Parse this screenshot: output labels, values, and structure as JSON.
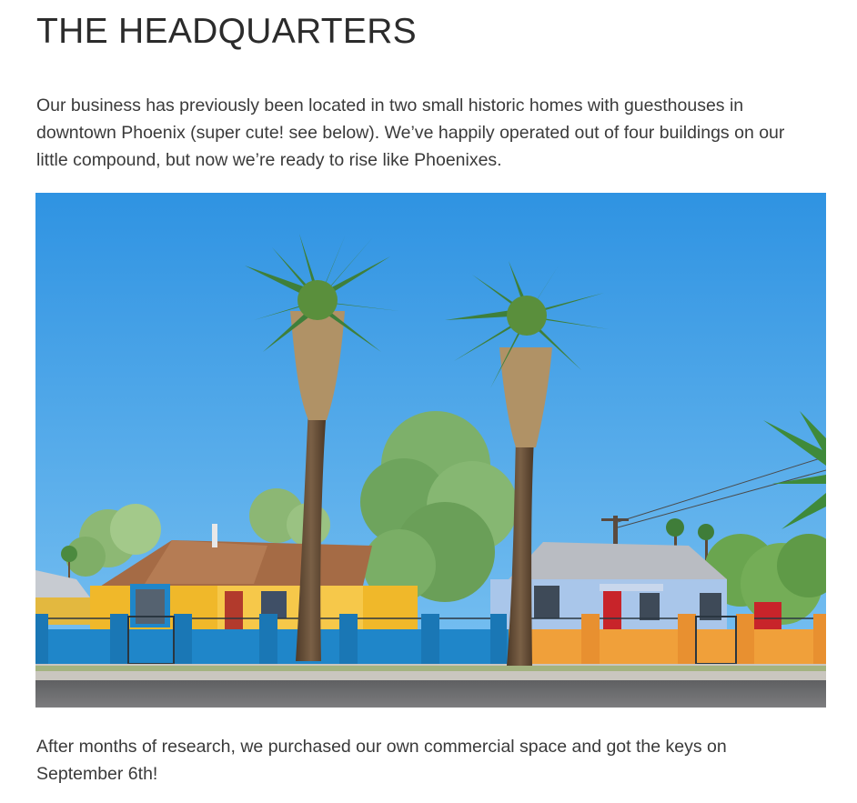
{
  "heading": "THE HEADQUARTERS",
  "intro_paragraph": "Our business has previously been located in two small historic homes with guesthouses in downtown Phoenix (super cute! see below). We’ve happily operated out of four buildings on our little compound, but now we’re ready to rise like Phoenixes.",
  "closing_paragraph": "After months of research, we purchased our own commercial space and got the keys on September 6th!",
  "colors": {
    "sky": "#3d9fe6",
    "yellow_house": "#f0b82a",
    "blue_house": "#a9c6ea",
    "blue_wall": "#1f86c9",
    "orange_wall": "#f0a03a",
    "palm_trunk": "#6b5238",
    "palm_leaves": "#3f7f3a",
    "road": "#6e6e70"
  }
}
